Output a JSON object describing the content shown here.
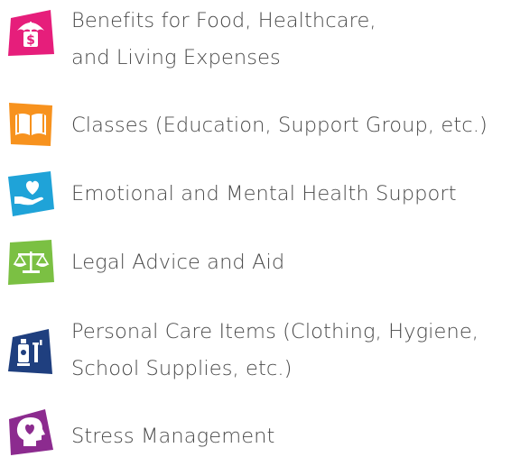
{
  "items": [
    {
      "icon": "umbrella-dollar-icon",
      "color": "#e61e7b",
      "lines": [
        "Benefits for Food, Healthcare,",
        "and Living Expenses"
      ]
    },
    {
      "icon": "open-book-icon",
      "color": "#f7921e",
      "lines": [
        "Classes (Education, Support Group, etc.)"
      ]
    },
    {
      "icon": "hand-heart-icon",
      "color": "#1fa3d8",
      "lines": [
        "Emotional and Mental Health Support"
      ]
    },
    {
      "icon": "scales-icon",
      "color": "#7bc043",
      "lines": [
        "Legal Advice and Aid"
      ]
    },
    {
      "icon": "toiletries-icon",
      "color": "#1f3f7f",
      "lines": [
        "Personal Care Items (Clothing, Hygiene,",
        "School Supplies, etc.)"
      ]
    },
    {
      "icon": "head-heart-icon",
      "color": "#8c2b8f",
      "lines": [
        "Stress Management"
      ]
    }
  ]
}
